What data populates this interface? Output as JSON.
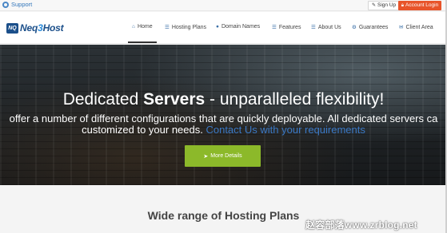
{
  "topbar": {
    "support_label": "Support",
    "signup_label": "Sign Up",
    "login_label": "Account Login",
    "login_color": "#e8542a"
  },
  "brand": {
    "logo_mark": "NQ",
    "logo_text_a": "Neq",
    "logo_text_num": "3",
    "logo_text_b": "Host"
  },
  "nav": {
    "items": [
      {
        "label": "Home",
        "icon": "home-icon"
      },
      {
        "label": "Hosting Plans",
        "icon": "list-icon"
      },
      {
        "label": "Domain Names",
        "icon": "globe-icon"
      },
      {
        "label": "Features",
        "icon": "list-icon"
      },
      {
        "label": "About Us",
        "icon": "list-icon"
      },
      {
        "label": "Guarantees",
        "icon": "gear-icon"
      },
      {
        "label": "Client Area",
        "icon": "envelope-icon"
      }
    ],
    "active": "Home"
  },
  "hero": {
    "title_normal": "Dedicated ",
    "title_bold": "Servers",
    "title_rest": " - unparalleled flexibility!",
    "line1": "offer a number of different configurations that are quickly deployable. All dedicated servers ca",
    "line2_text": "customized to your needs. ",
    "line2_link": "Contact Us with your requirements",
    "button_label": "More Details",
    "button_color": "#8cb92a"
  },
  "section": {
    "title": "Wide range of Hosting Plans"
  },
  "watermark": {
    "text": "赵容部落www.zrblog.net"
  }
}
